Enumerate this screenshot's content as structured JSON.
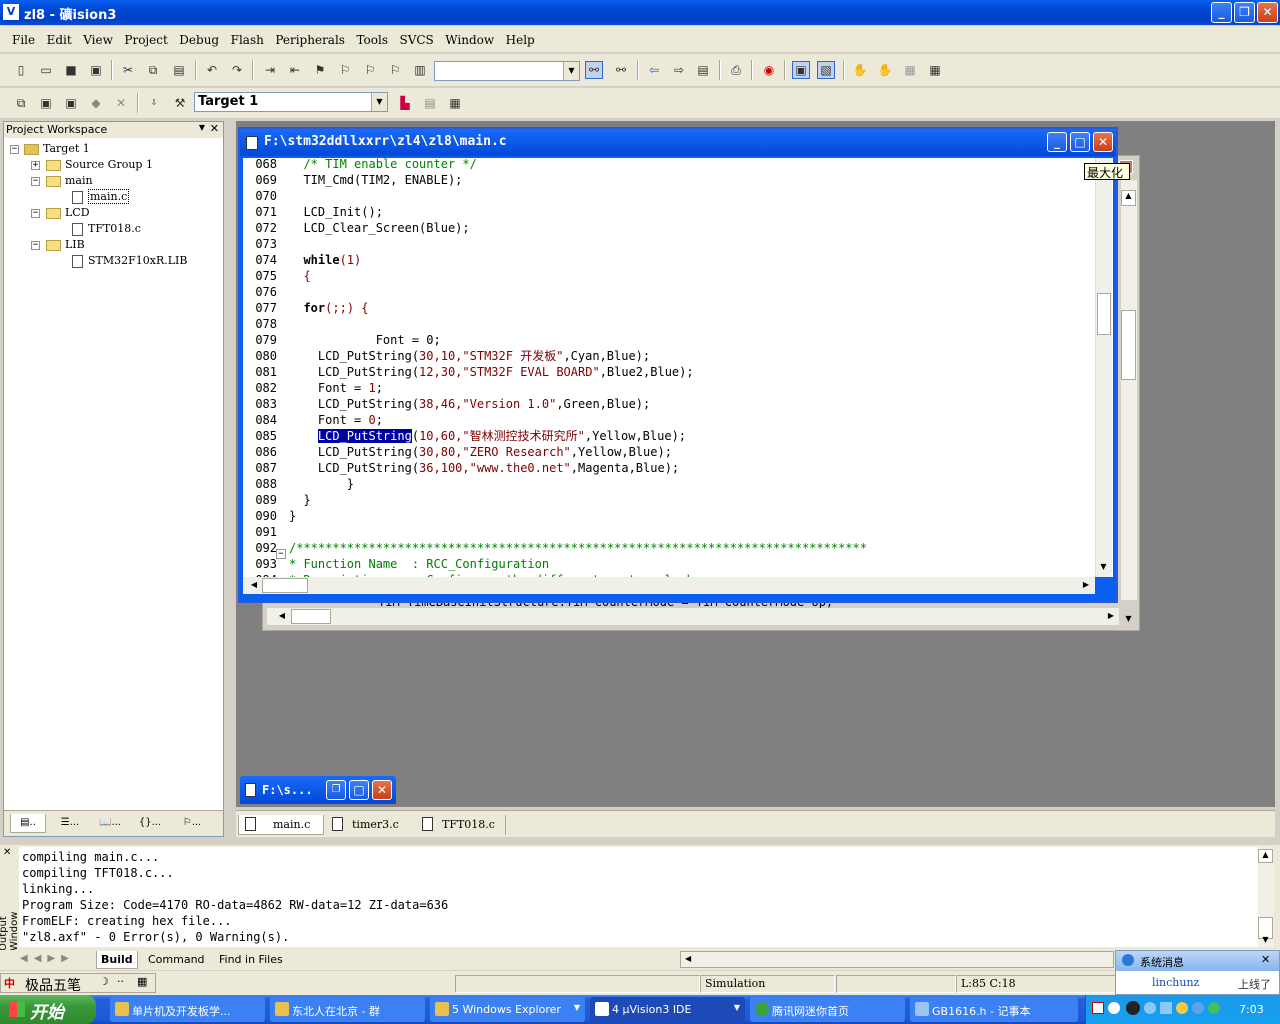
{
  "window": {
    "title": "zl8  - 礦ision3",
    "app_icon": "V"
  },
  "menu": [
    "File",
    "Edit",
    "View",
    "Project",
    "Debug",
    "Flash",
    "Peripherals",
    "Tools",
    "SVCS",
    "Window",
    "Help"
  ],
  "toolbar": {
    "target_select": "Target 1",
    "find_value": ""
  },
  "workspace": {
    "title": "Project Workspace",
    "tree": {
      "root": "Target 1",
      "source_group": "Source Group 1",
      "main": "main",
      "main_c": "main.c",
      "lcd": "LCD",
      "tft": "TFT018.c",
      "lib": "LIB",
      "lib_file": "STM32F10xR.LIB"
    },
    "tabs": [
      "..",
      "...",
      "...",
      "{}...",
      "..."
    ]
  },
  "editor": {
    "title": "F:\\stm32ddllxxrr\\zl4\\zl8\\main.c",
    "tooltip": "最大化",
    "lines": [
      {
        "n": "068",
        "segs": [
          {
            "t": "  /* TIM enable counter */",
            "c": "cmt"
          }
        ]
      },
      {
        "n": "069",
        "segs": [
          {
            "t": "  TIM_Cmd(TIM2, ENABLE);",
            "c": ""
          }
        ]
      },
      {
        "n": "070",
        "segs": [
          {
            "t": "",
            "c": ""
          }
        ]
      },
      {
        "n": "071",
        "segs": [
          {
            "t": "  LCD_Init();",
            "c": ""
          }
        ]
      },
      {
        "n": "072",
        "segs": [
          {
            "t": "  LCD_Clear_Screen(Blue);",
            "c": ""
          }
        ]
      },
      {
        "n": "073",
        "segs": [
          {
            "t": "",
            "c": ""
          }
        ]
      },
      {
        "n": "074",
        "segs": [
          {
            "t": "  ",
            "c": ""
          },
          {
            "t": "while",
            "c": "kw"
          },
          {
            "t": "(1)",
            "c": "num"
          }
        ]
      },
      {
        "n": "075",
        "segs": [
          {
            "t": "  {",
            "c": "num"
          }
        ]
      },
      {
        "n": "076",
        "segs": [
          {
            "t": "",
            "c": ""
          }
        ]
      },
      {
        "n": "077",
        "segs": [
          {
            "t": "  ",
            "c": ""
          },
          {
            "t": "for",
            "c": "kw"
          },
          {
            "t": "(;;) {",
            "c": "num"
          }
        ]
      },
      {
        "n": "078",
        "segs": [
          {
            "t": "",
            "c": ""
          }
        ]
      },
      {
        "n": "079",
        "segs": [
          {
            "t": "            Font = 0;",
            "c": ""
          }
        ]
      },
      {
        "n": "080",
        "segs": [
          {
            "t": "    LCD_PutString(",
            "c": ""
          },
          {
            "t": "30,10,",
            "c": "num"
          },
          {
            "t": "\"STM32F 开发板\"",
            "c": "str"
          },
          {
            "t": ",Cyan,Blue);",
            "c": ""
          }
        ]
      },
      {
        "n": "081",
        "segs": [
          {
            "t": "    LCD_PutString(",
            "c": ""
          },
          {
            "t": "12,30,",
            "c": "num"
          },
          {
            "t": "\"STM32F EVAL BOARD\"",
            "c": "str"
          },
          {
            "t": ",Blue2,Blue);",
            "c": ""
          }
        ]
      },
      {
        "n": "082",
        "segs": [
          {
            "t": "    Font = ",
            "c": ""
          },
          {
            "t": "1",
            "c": "num"
          },
          {
            "t": ";",
            "c": ""
          }
        ]
      },
      {
        "n": "083",
        "segs": [
          {
            "t": "    LCD_PutString(",
            "c": ""
          },
          {
            "t": "38,46,",
            "c": "num"
          },
          {
            "t": "\"Version 1.0\"",
            "c": "str"
          },
          {
            "t": ",Green,Blue);",
            "c": ""
          }
        ]
      },
      {
        "n": "084",
        "segs": [
          {
            "t": "    Font = ",
            "c": ""
          },
          {
            "t": "0",
            "c": "num"
          },
          {
            "t": ";",
            "c": ""
          }
        ]
      },
      {
        "n": "085",
        "segs": [
          {
            "t": "    ",
            "c": ""
          },
          {
            "t": "LCD_PutString",
            "c": "sel"
          },
          {
            "t": "(",
            "c": ""
          },
          {
            "t": "10,60,",
            "c": "num"
          },
          {
            "t": "\"智林测控技术研究所\"",
            "c": "str"
          },
          {
            "t": ",Yellow,Blue);",
            "c": ""
          }
        ]
      },
      {
        "n": "086",
        "segs": [
          {
            "t": "    LCD_PutString(",
            "c": ""
          },
          {
            "t": "30,80,",
            "c": "num"
          },
          {
            "t": "\"ZERO Research\"",
            "c": "str"
          },
          {
            "t": ",Yellow,Blue);",
            "c": ""
          }
        ]
      },
      {
        "n": "087",
        "segs": [
          {
            "t": "    LCD_PutString(",
            "c": ""
          },
          {
            "t": "36,100,",
            "c": "num"
          },
          {
            "t": "\"www.the0.net\"",
            "c": "str"
          },
          {
            "t": ",Magenta,Blue);",
            "c": ""
          }
        ]
      },
      {
        "n": "088",
        "segs": [
          {
            "t": "        }",
            "c": ""
          }
        ]
      },
      {
        "n": "089",
        "segs": [
          {
            "t": "  }",
            "c": ""
          }
        ]
      },
      {
        "n": "090",
        "segs": [
          {
            "t": "}",
            "c": ""
          }
        ]
      },
      {
        "n": "091",
        "segs": [
          {
            "t": "",
            "c": ""
          }
        ]
      },
      {
        "n": "092",
        "segs": [
          {
            "t": "/*******************************************************************************",
            "c": "cmt"
          }
        ]
      },
      {
        "n": "093",
        "segs": [
          {
            "t": "* Function Name  : RCC_Configuration",
            "c": "cmt"
          }
        ]
      },
      {
        "n": "094",
        "segs": [
          {
            "t": "* Description    : Configures the different system clocks.",
            "c": "cmt"
          }
        ]
      }
    ],
    "back_line": "TIM_TimeBaseInitStructure.TIM_CounterMode = TIM_CounterMode_Up;"
  },
  "minimized": {
    "title": "F:\\s..."
  },
  "doc_tabs": [
    "main.c",
    "timer3.c",
    "TFT018.c"
  ],
  "output": {
    "side_label": "Output Window",
    "lines": [
      "compiling main.c...",
      "compiling TFT018.c...",
      "linking...",
      "Program Size: Code=4170 RO-data=4862 RW-data=12 ZI-data=636",
      "FromELF: creating hex file...",
      "\"zl8.axf\" - 0 Error(s), 0 Warning(s)."
    ],
    "tabs": [
      "Build",
      "Command",
      "Find in Files"
    ]
  },
  "status": {
    "mode": "Simulation",
    "position": "L:85 C:18",
    "ime": "极品五笔"
  },
  "notify": {
    "title": "系统消息",
    "user": "linchunz",
    "msg": "上线了"
  },
  "taskbar": {
    "start": "开始",
    "tasks": [
      "单片机及开发板学...",
      "东北人在北京 - 群",
      "5 Windows Explorer",
      "4 µVision3 IDE",
      "腾讯网迷你首页",
      "GB1616.h - 记事本"
    ],
    "clock": "7:03"
  }
}
